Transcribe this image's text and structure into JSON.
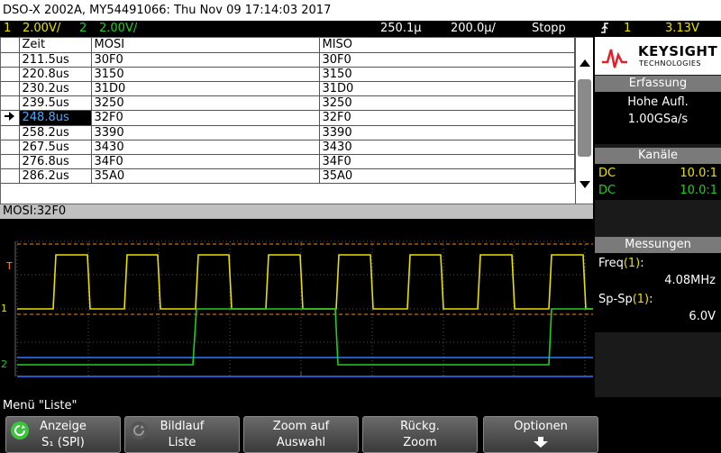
{
  "title": "DSO-X 2002A, MY54491066: Thu Nov 09 17:14:03 2017",
  "status": {
    "ch1_num": "1",
    "ch1_scale": "2.00V/",
    "ch2_num": "2",
    "ch2_scale": "2.00V/",
    "timebase": "250.1µ",
    "sample": "200.0µ/",
    "run_state": "Stopp",
    "trigger_ch": "1",
    "trigger_level": "3.13V"
  },
  "list": {
    "headers": {
      "time": "Zeit",
      "mosi": "MOSI",
      "miso": "MISO"
    },
    "rows": [
      {
        "time": "211.5us",
        "mosi": "30F0",
        "miso": "30F0",
        "selected": false
      },
      {
        "time": "220.8us",
        "mosi": "3150",
        "miso": "3150",
        "selected": false
      },
      {
        "time": "230.2us",
        "mosi": "31D0",
        "miso": "31D0",
        "selected": false
      },
      {
        "time": "239.5us",
        "mosi": "3250",
        "miso": "3250",
        "selected": false
      },
      {
        "time": "248.8us",
        "mosi": "32F0",
        "miso": "32F0",
        "selected": true
      },
      {
        "time": "258.2us",
        "mosi": "3390",
        "miso": "3390",
        "selected": false
      },
      {
        "time": "267.5us",
        "mosi": "3430",
        "miso": "3430",
        "selected": false
      },
      {
        "time": "276.8us",
        "mosi": "34F0",
        "miso": "34F0",
        "selected": false
      },
      {
        "time": "286.2us",
        "mosi": "35A0",
        "miso": "35A0",
        "selected": false
      }
    ]
  },
  "decode_line": "MOSI:32F0",
  "markers": {
    "trigger": "T",
    "ch1": "1",
    "ch2": "2"
  },
  "brand": {
    "name": "KEYSIGHT",
    "sub": "TECHNOLOGIES"
  },
  "acquisition": {
    "heading": "Erfassung",
    "mode": "Hohe Aufl.",
    "rate": "1.00GSa/s"
  },
  "channels": {
    "heading": "Kanäle",
    "ch1": {
      "coupling": "DC",
      "probe": "10.0:1"
    },
    "ch2": {
      "coupling": "DC",
      "probe": "10.0:1"
    }
  },
  "measurements": {
    "heading": "Messungen",
    "m1_label": "Freq",
    "m1_src": "(1)",
    "m1_sep": ":",
    "m1_value": "4.08MHz",
    "m2_label": "Sp-Sp",
    "m2_src": "(1)",
    "m2_sep": ":",
    "m2_value": "6.0V"
  },
  "menu_label": "Menü \"Liste\"",
  "softkeys": [
    {
      "line1": "Anzeige",
      "line2": "S₁ (SPI)"
    },
    {
      "line1": "Bildlauf",
      "line2": "Liste"
    },
    {
      "line1": "Zoom auf",
      "line2": "Auswahl"
    },
    {
      "line1": "Rückg.",
      "line2": "Zoom"
    },
    {
      "line1": "Optionen",
      "line2": ""
    }
  ],
  "colors": {
    "ch1": "#e8e000",
    "ch2": "#22cc22",
    "trigger": "#ff8800",
    "cursor": "#3377ff",
    "grid": "#555555",
    "selected_text": "#4da6ff"
  }
}
